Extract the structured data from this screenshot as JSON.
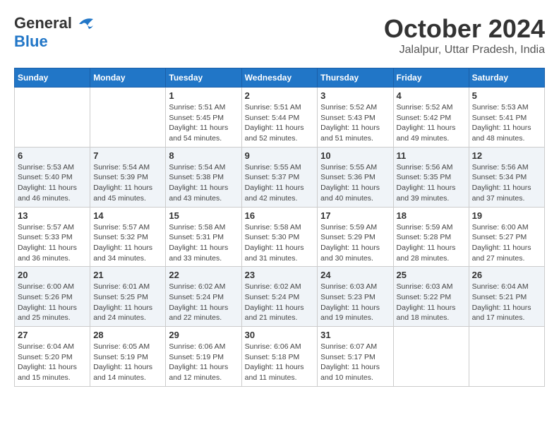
{
  "header": {
    "logo_general": "General",
    "logo_blue": "Blue",
    "month_title": "October 2024",
    "location": "Jalalpur, Uttar Pradesh, India"
  },
  "calendar": {
    "days_of_week": [
      "Sunday",
      "Monday",
      "Tuesday",
      "Wednesday",
      "Thursday",
      "Friday",
      "Saturday"
    ],
    "weeks": [
      [
        {
          "day": "",
          "sunrise": "",
          "sunset": "",
          "daylight": ""
        },
        {
          "day": "",
          "sunrise": "",
          "sunset": "",
          "daylight": ""
        },
        {
          "day": "1",
          "sunrise": "Sunrise: 5:51 AM",
          "sunset": "Sunset: 5:45 PM",
          "daylight": "Daylight: 11 hours and 54 minutes."
        },
        {
          "day": "2",
          "sunrise": "Sunrise: 5:51 AM",
          "sunset": "Sunset: 5:44 PM",
          "daylight": "Daylight: 11 hours and 52 minutes."
        },
        {
          "day": "3",
          "sunrise": "Sunrise: 5:52 AM",
          "sunset": "Sunset: 5:43 PM",
          "daylight": "Daylight: 11 hours and 51 minutes."
        },
        {
          "day": "4",
          "sunrise": "Sunrise: 5:52 AM",
          "sunset": "Sunset: 5:42 PM",
          "daylight": "Daylight: 11 hours and 49 minutes."
        },
        {
          "day": "5",
          "sunrise": "Sunrise: 5:53 AM",
          "sunset": "Sunset: 5:41 PM",
          "daylight": "Daylight: 11 hours and 48 minutes."
        }
      ],
      [
        {
          "day": "6",
          "sunrise": "Sunrise: 5:53 AM",
          "sunset": "Sunset: 5:40 PM",
          "daylight": "Daylight: 11 hours and 46 minutes."
        },
        {
          "day": "7",
          "sunrise": "Sunrise: 5:54 AM",
          "sunset": "Sunset: 5:39 PM",
          "daylight": "Daylight: 11 hours and 45 minutes."
        },
        {
          "day": "8",
          "sunrise": "Sunrise: 5:54 AM",
          "sunset": "Sunset: 5:38 PM",
          "daylight": "Daylight: 11 hours and 43 minutes."
        },
        {
          "day": "9",
          "sunrise": "Sunrise: 5:55 AM",
          "sunset": "Sunset: 5:37 PM",
          "daylight": "Daylight: 11 hours and 42 minutes."
        },
        {
          "day": "10",
          "sunrise": "Sunrise: 5:55 AM",
          "sunset": "Sunset: 5:36 PM",
          "daylight": "Daylight: 11 hours and 40 minutes."
        },
        {
          "day": "11",
          "sunrise": "Sunrise: 5:56 AM",
          "sunset": "Sunset: 5:35 PM",
          "daylight": "Daylight: 11 hours and 39 minutes."
        },
        {
          "day": "12",
          "sunrise": "Sunrise: 5:56 AM",
          "sunset": "Sunset: 5:34 PM",
          "daylight": "Daylight: 11 hours and 37 minutes."
        }
      ],
      [
        {
          "day": "13",
          "sunrise": "Sunrise: 5:57 AM",
          "sunset": "Sunset: 5:33 PM",
          "daylight": "Daylight: 11 hours and 36 minutes."
        },
        {
          "day": "14",
          "sunrise": "Sunrise: 5:57 AM",
          "sunset": "Sunset: 5:32 PM",
          "daylight": "Daylight: 11 hours and 34 minutes."
        },
        {
          "day": "15",
          "sunrise": "Sunrise: 5:58 AM",
          "sunset": "Sunset: 5:31 PM",
          "daylight": "Daylight: 11 hours and 33 minutes."
        },
        {
          "day": "16",
          "sunrise": "Sunrise: 5:58 AM",
          "sunset": "Sunset: 5:30 PM",
          "daylight": "Daylight: 11 hours and 31 minutes."
        },
        {
          "day": "17",
          "sunrise": "Sunrise: 5:59 AM",
          "sunset": "Sunset: 5:29 PM",
          "daylight": "Daylight: 11 hours and 30 minutes."
        },
        {
          "day": "18",
          "sunrise": "Sunrise: 5:59 AM",
          "sunset": "Sunset: 5:28 PM",
          "daylight": "Daylight: 11 hours and 28 minutes."
        },
        {
          "day": "19",
          "sunrise": "Sunrise: 6:00 AM",
          "sunset": "Sunset: 5:27 PM",
          "daylight": "Daylight: 11 hours and 27 minutes."
        }
      ],
      [
        {
          "day": "20",
          "sunrise": "Sunrise: 6:00 AM",
          "sunset": "Sunset: 5:26 PM",
          "daylight": "Daylight: 11 hours and 25 minutes."
        },
        {
          "day": "21",
          "sunrise": "Sunrise: 6:01 AM",
          "sunset": "Sunset: 5:25 PM",
          "daylight": "Daylight: 11 hours and 24 minutes."
        },
        {
          "day": "22",
          "sunrise": "Sunrise: 6:02 AM",
          "sunset": "Sunset: 5:24 PM",
          "daylight": "Daylight: 11 hours and 22 minutes."
        },
        {
          "day": "23",
          "sunrise": "Sunrise: 6:02 AM",
          "sunset": "Sunset: 5:24 PM",
          "daylight": "Daylight: 11 hours and 21 minutes."
        },
        {
          "day": "24",
          "sunrise": "Sunrise: 6:03 AM",
          "sunset": "Sunset: 5:23 PM",
          "daylight": "Daylight: 11 hours and 19 minutes."
        },
        {
          "day": "25",
          "sunrise": "Sunrise: 6:03 AM",
          "sunset": "Sunset: 5:22 PM",
          "daylight": "Daylight: 11 hours and 18 minutes."
        },
        {
          "day": "26",
          "sunrise": "Sunrise: 6:04 AM",
          "sunset": "Sunset: 5:21 PM",
          "daylight": "Daylight: 11 hours and 17 minutes."
        }
      ],
      [
        {
          "day": "27",
          "sunrise": "Sunrise: 6:04 AM",
          "sunset": "Sunset: 5:20 PM",
          "daylight": "Daylight: 11 hours and 15 minutes."
        },
        {
          "day": "28",
          "sunrise": "Sunrise: 6:05 AM",
          "sunset": "Sunset: 5:19 PM",
          "daylight": "Daylight: 11 hours and 14 minutes."
        },
        {
          "day": "29",
          "sunrise": "Sunrise: 6:06 AM",
          "sunset": "Sunset: 5:19 PM",
          "daylight": "Daylight: 11 hours and 12 minutes."
        },
        {
          "day": "30",
          "sunrise": "Sunrise: 6:06 AM",
          "sunset": "Sunset: 5:18 PM",
          "daylight": "Daylight: 11 hours and 11 minutes."
        },
        {
          "day": "31",
          "sunrise": "Sunrise: 6:07 AM",
          "sunset": "Sunset: 5:17 PM",
          "daylight": "Daylight: 11 hours and 10 minutes."
        },
        {
          "day": "",
          "sunrise": "",
          "sunset": "",
          "daylight": ""
        },
        {
          "day": "",
          "sunrise": "",
          "sunset": "",
          "daylight": ""
        }
      ]
    ]
  }
}
